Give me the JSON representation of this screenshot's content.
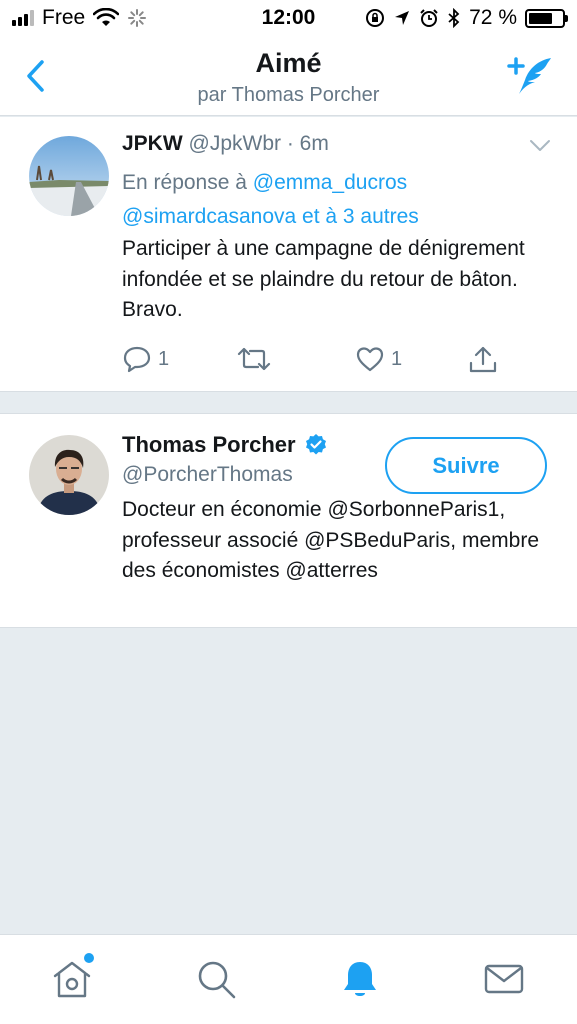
{
  "status_bar": {
    "carrier": "Free",
    "time": "12:00",
    "battery": "72 %",
    "battery_level": 0.72
  },
  "nav": {
    "title": "Aimé",
    "subtitle": "par Thomas Porcher",
    "icons": {
      "back": "chevron-left-icon",
      "compose": "compose-tweet-icon"
    }
  },
  "tweet": {
    "name": "JPKW",
    "handle_time": "@JpkWbr · 6m",
    "reply_prefix": "En réponse à ",
    "reply_mention1": "@emma_ducros",
    "reply_mention2": "@simardcasanova et à 3 autres",
    "text": "Participer à une campagne de dénigrement infondée et se plaindre du retour de bâton. Bravo.",
    "reply_count": "1",
    "like_count": "1"
  },
  "profile_card": {
    "name": "Thomas Porcher",
    "handle": "@PorcherThomas",
    "follow_label": "Suivre",
    "bio": "Docteur en économie @SorbonneParis1, professeur associé @PSBeduParis, membre des économistes @atterres"
  },
  "tabbar": {
    "items": [
      "home-icon",
      "search-icon",
      "notifications-icon",
      "messages-icon"
    ],
    "active": "notifications-icon"
  },
  "colors": {
    "accent": "#1da1f2",
    "muted": "#657786",
    "text": "#14171a",
    "background": "#e6ecf0"
  }
}
